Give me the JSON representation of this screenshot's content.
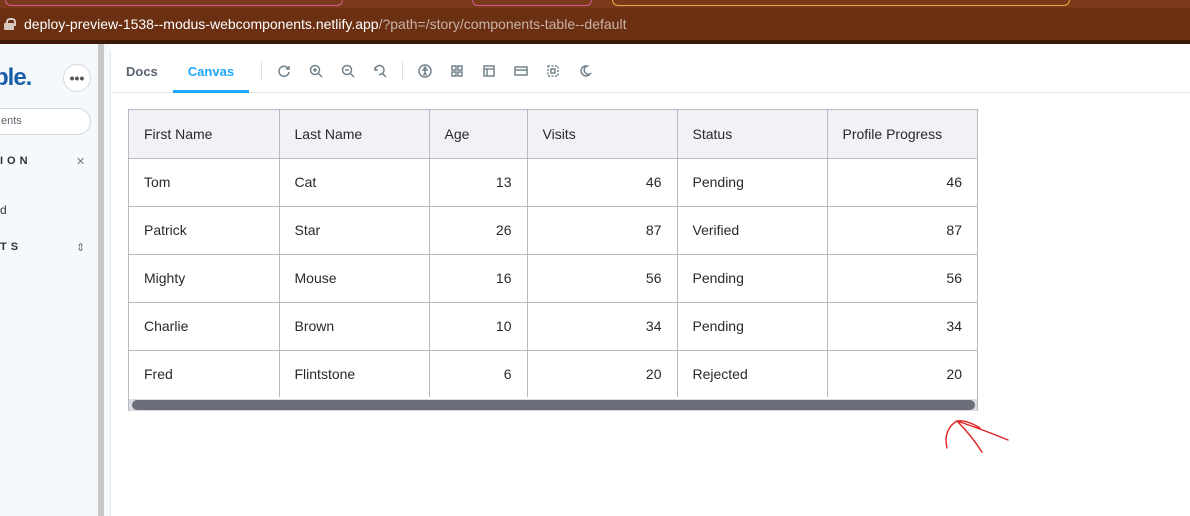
{
  "browser": {
    "url_host": "deploy-preview-1538--modus-webcomponents.netlify.app",
    "url_path": "/?path=/story/components-table--default"
  },
  "sidebar": {
    "logo": "ble.",
    "more_label": "•••",
    "search_placeholder": "ents",
    "sections": [
      {
        "label": "ION",
        "icon": "✕"
      },
      {
        "label": "TS",
        "icon": "⇕"
      }
    ],
    "item_label": "d"
  },
  "toolbar": {
    "tabs": [
      {
        "label": "Docs",
        "active": false
      },
      {
        "label": "Canvas",
        "active": true
      }
    ],
    "tools": [
      "refresh-icon",
      "zoom-in-icon",
      "zoom-out-icon",
      "zoom-reset-icon",
      "accessibility-icon",
      "grid-icon",
      "background-icon",
      "viewport-icon",
      "outline-icon",
      "dark-mode-icon"
    ]
  },
  "table": {
    "columns": [
      "First Name",
      "Last Name",
      "Age",
      "Visits",
      "Status",
      "Profile Progress"
    ],
    "rows": [
      [
        "Tom",
        "Cat",
        "13",
        "46",
        "Pending",
        "46"
      ],
      [
        "Patrick",
        "Star",
        "26",
        "87",
        "Verified",
        "87"
      ],
      [
        "Mighty",
        "Mouse",
        "16",
        "56",
        "Pending",
        "56"
      ],
      [
        "Charlie",
        "Brown",
        "10",
        "34",
        "Pending",
        "34"
      ],
      [
        "Fred",
        "Flintstone",
        "6",
        "20",
        "Rejected",
        "20"
      ]
    ],
    "scroll_position": 0
  },
  "colors": {
    "accent": "#1ea7fd",
    "header_bg": "#f1f1f6",
    "border": "#b7b9c3",
    "annotation": "#e02020"
  }
}
